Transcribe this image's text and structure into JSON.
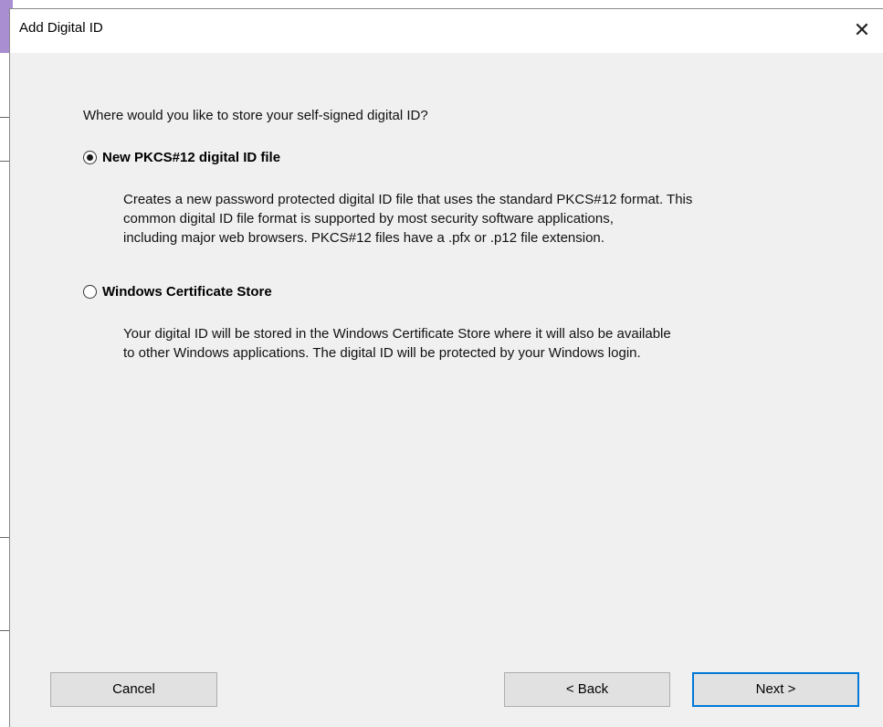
{
  "dialog": {
    "title": "Add Digital ID",
    "close_glyph": "✕"
  },
  "content": {
    "question": "Where would you like to store your self-signed digital ID?",
    "options": [
      {
        "label": "New PKCS#12 digital ID file",
        "checked": true,
        "description": [
          "Creates a new password protected digital ID file that uses the standard PKCS#12 format. This",
          "common digital ID file format is supported by most security software applications,",
          "including major web browsers. PKCS#12 files have a .pfx or .p12 file extension."
        ]
      },
      {
        "label": "Windows Certificate Store",
        "checked": false,
        "description": [
          "Your digital ID will be stored in the Windows Certificate Store where it will also be available",
          "to other Windows applications. The digital ID will be protected by your Windows login."
        ]
      }
    ]
  },
  "buttons": {
    "cancel": "Cancel",
    "back": "< Back",
    "next": "Next >"
  },
  "colors": {
    "focus_accent": "#0078d7",
    "background_app_accent": "#a98fd1"
  }
}
